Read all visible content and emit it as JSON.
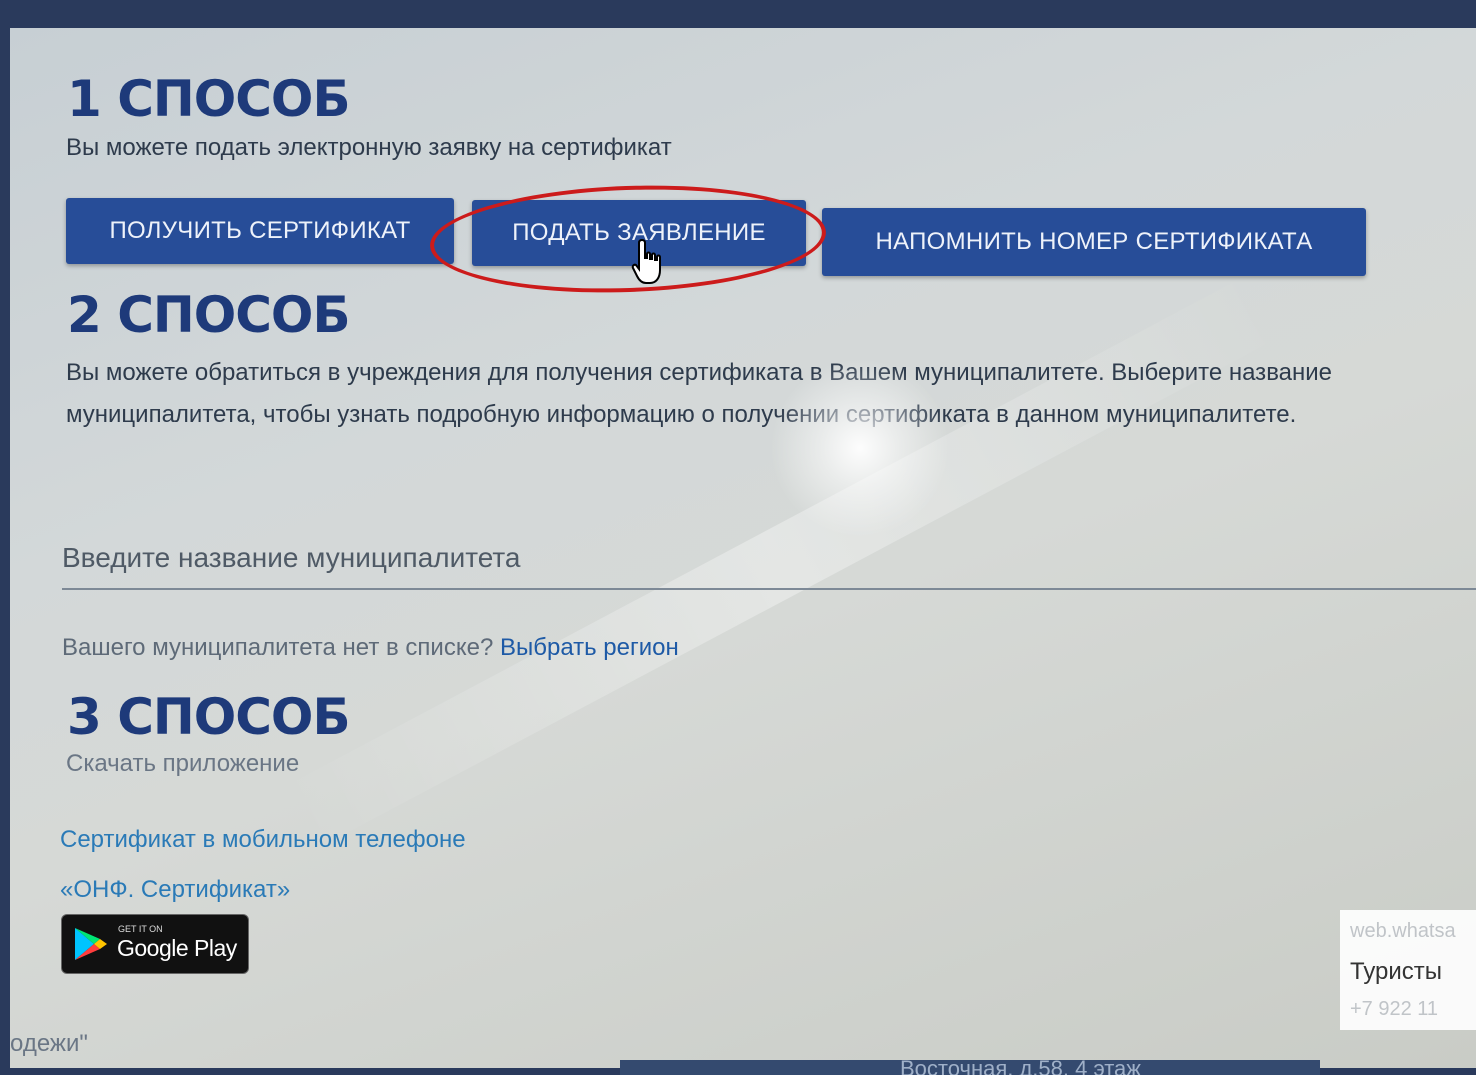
{
  "method1": {
    "title": "1 СПОСОБ",
    "description": "Вы можете подать электронную заявку на сертификат",
    "buttons": {
      "get_certificate": "ПОЛУЧИТЬ СЕРТИФИКАТ",
      "submit_application": "ПОДАТЬ ЗАЯВЛЕНИЕ",
      "remind_number": "НАПОМНИТЬ НОМЕР СЕРТИФИКАТА"
    }
  },
  "method2": {
    "title": "2 СПОСОБ",
    "description": "Вы можете обратиться в учреждения для получения сертификата в Вашем муниципалитете. Выберите название муниципалитета, чтобы узнать подробную информацию о получении сертификата в данном муниципалитете.",
    "search_placeholder": "Введите название муниципалитета",
    "missing_text": "Вашего муниципалитета нет в списке?",
    "choose_region": "Выбрать регион"
  },
  "method3": {
    "title": "3 СПОСОБ",
    "description": "Скачать приложение",
    "mobile_link": "Сертификат в мобильном телефоне",
    "app_name": "«ОНФ. Сертификат»",
    "store_badge": {
      "small": "GET IT ON",
      "big": "Google Play"
    }
  },
  "chat_popup": {
    "domain": "web.whatsa",
    "name": "Туристы",
    "phone": "+7 922 11"
  },
  "footer": {
    "left_text": "одежи\"",
    "strip_text": "Восточная, д.58, 4 этаж"
  },
  "colors": {
    "accent_blue": "#274d98",
    "title_blue": "#1e3a7a",
    "link_blue": "#1e5aa6",
    "highlight_red": "#cc1b1b"
  },
  "icons": [
    "hand-cursor-icon",
    "google-play-icon"
  ]
}
